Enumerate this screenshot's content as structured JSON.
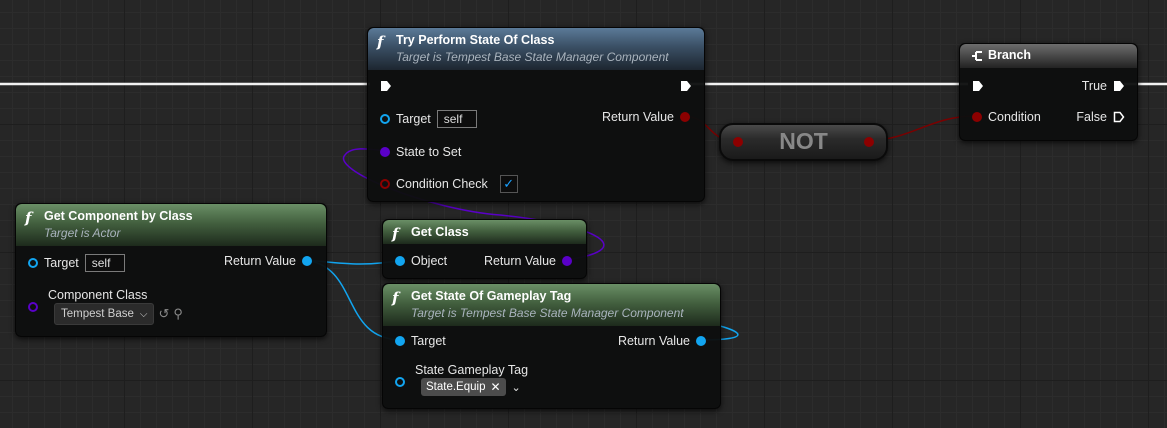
{
  "nodes": {
    "try_perform": {
      "title": "Try Perform State Of Class",
      "subtitle": "Target is Tempest Base State Manager Component",
      "icon": "function-icon",
      "pins": {
        "target_label": "Target",
        "target_value": "self",
        "state_to_set_label": "State to Set",
        "condition_check_label": "Condition Check",
        "condition_check_value": "✓",
        "return_value_label": "Return Value"
      }
    },
    "branch": {
      "title": "Branch",
      "icon": "branch-icon",
      "pins": {
        "condition_label": "Condition",
        "true_label": "True",
        "false_label": "False"
      }
    },
    "not": {
      "title": "NOT"
    },
    "get_component": {
      "title": "Get Component by Class",
      "subtitle": "Target is Actor",
      "icon": "function-icon",
      "pins": {
        "target_label": "Target",
        "target_value": "self",
        "return_value_label": "Return Value",
        "component_class_label": "Component Class",
        "component_class_value": "Tempest Base"
      }
    },
    "get_class": {
      "title": "Get Class",
      "icon": "function-icon",
      "pins": {
        "object_label": "Object",
        "return_value_label": "Return Value"
      }
    },
    "get_state": {
      "title": "Get State Of Gameplay Tag",
      "subtitle": "Target is Tempest Base State Manager Component",
      "icon": "function-icon",
      "pins": {
        "target_label": "Target",
        "return_value_label": "Return Value",
        "tag_label": "State Gameplay Tag",
        "tag_value": "State.Equip"
      }
    }
  },
  "colors": {
    "object_pin": "#12a5f0",
    "class_pin": "#5a00c8",
    "bool_pin": "#8c0000",
    "exec_wire": "#ffffff"
  }
}
